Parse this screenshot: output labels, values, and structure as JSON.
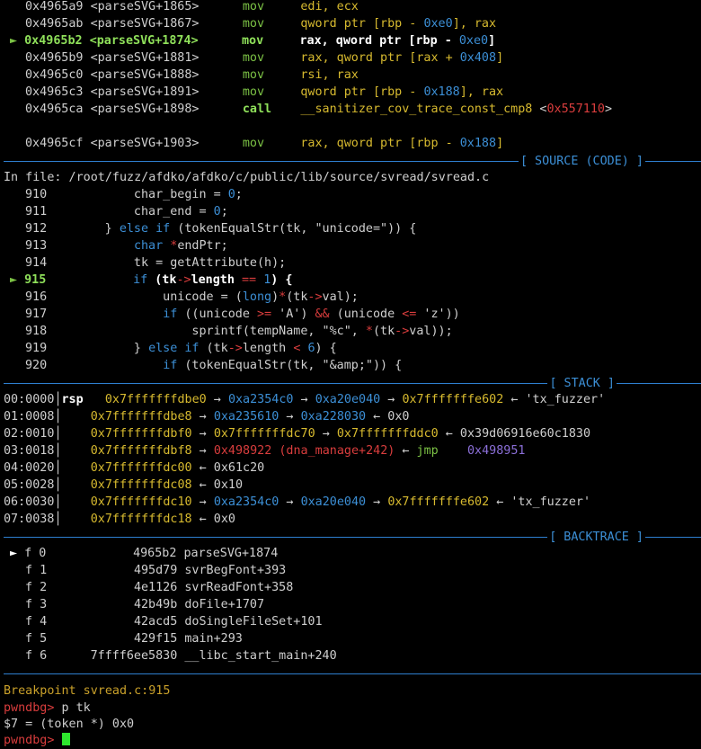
{
  "disasm": [
    {
      "addr": "0x4965a9",
      "sym": "<parseSVG+1865>",
      "op": "mov",
      "args": [
        {
          "t": "edi, ecx",
          "c": "yel"
        }
      ]
    },
    {
      "addr": "0x4965ab",
      "sym": "<parseSVG+1867>",
      "op": "mov",
      "args": [
        {
          "t": "qword ptr [rbp - ",
          "c": "yel"
        },
        {
          "t": "0xe0",
          "c": "cy"
        },
        {
          "t": "], rax",
          "c": "yel"
        }
      ]
    },
    {
      "addr": "0x4965b2",
      "sym": "<parseSVG+1874>",
      "op": "mov",
      "current": true,
      "args": [
        {
          "t": "rax, qword ptr [rbp - ",
          "c": "wb"
        },
        {
          "t": "0xe0",
          "c": "cy"
        },
        {
          "t": "]",
          "c": "wb"
        }
      ]
    },
    {
      "addr": "0x4965b9",
      "sym": "<parseSVG+1881>",
      "op": "mov",
      "args": [
        {
          "t": "rax, qword ptr [rax + ",
          "c": "yel"
        },
        {
          "t": "0x408",
          "c": "cy"
        },
        {
          "t": "]",
          "c": "yel"
        }
      ]
    },
    {
      "addr": "0x4965c0",
      "sym": "<parseSVG+1888>",
      "op": "mov",
      "args": [
        {
          "t": "rsi, rax",
          "c": "yel"
        }
      ]
    },
    {
      "addr": "0x4965c3",
      "sym": "<parseSVG+1891>",
      "op": "mov",
      "args": [
        {
          "t": "qword ptr [rbp - ",
          "c": "yel"
        },
        {
          "t": "0x188",
          "c": "cy"
        },
        {
          "t": "], rax",
          "c": "yel"
        }
      ]
    },
    {
      "addr": "0x4965ca",
      "sym": "<parseSVG+1898>",
      "op": "call",
      "args": [
        {
          "t": "__sanitizer_cov_trace_const_cmp8",
          "c": "yel"
        },
        {
          "t": " <",
          "c": "w"
        },
        {
          "t": "0x557110",
          "c": "red"
        },
        {
          "t": ">",
          "c": "w"
        }
      ]
    },
    {
      "blank": true
    },
    {
      "addr": "0x4965cf",
      "sym": "<parseSVG+1903>",
      "op": "mov",
      "args": [
        {
          "t": "rax, qword ptr [rbp - ",
          "c": "yel"
        },
        {
          "t": "0x188",
          "c": "cy"
        },
        {
          "t": "]",
          "c": "yel"
        }
      ]
    }
  ],
  "sections": {
    "source": "[ SOURCE (CODE) ]",
    "stack": "[ STACK ]",
    "backtrace": "[ BACKTRACE ]"
  },
  "source": {
    "file_line": "In file: /root/fuzz/afdko/afdko/c/public/lib/source/svread/svread.c",
    "lines": [
      {
        "no": "910",
        "segs": [
          {
            "t": "            char_begin = ",
            "c": "w"
          },
          {
            "t": "0",
            "c": "cy"
          },
          {
            "t": ";",
            "c": "w"
          }
        ]
      },
      {
        "no": "911",
        "segs": [
          {
            "t": "            char_end = ",
            "c": "w"
          },
          {
            "t": "0",
            "c": "cy"
          },
          {
            "t": ";",
            "c": "w"
          }
        ]
      },
      {
        "no": "912",
        "segs": [
          {
            "t": "        } ",
            "c": "w"
          },
          {
            "t": "else if",
            "c": "cy"
          },
          {
            "t": " (tokenEqualStr(tk, ",
            "c": "w"
          },
          {
            "t": "\"unicode=\"",
            "c": "w"
          },
          {
            "t": ")) {",
            "c": "w"
          }
        ]
      },
      {
        "no": "913",
        "segs": [
          {
            "t": "            ",
            "c": "w"
          },
          {
            "t": "char",
            "c": "cy"
          },
          {
            "t": " ",
            "c": "w"
          },
          {
            "t": "*",
            "c": "red"
          },
          {
            "t": "endPtr;",
            "c": "w"
          }
        ]
      },
      {
        "no": "914",
        "segs": [
          {
            "t": "            tk = getAttribute(h);",
            "c": "w"
          }
        ]
      },
      {
        "no": "915",
        "current": true,
        "segs": [
          {
            "t": "            ",
            "c": "w"
          },
          {
            "t": "if",
            "c": "cy"
          },
          {
            "t": " (tk",
            "c": "wb"
          },
          {
            "t": "->",
            "c": "red"
          },
          {
            "t": "length ",
            "c": "wb"
          },
          {
            "t": "==",
            "c": "red"
          },
          {
            "t": " ",
            "c": "wb"
          },
          {
            "t": "1",
            "c": "cy"
          },
          {
            "t": ") {",
            "c": "wb"
          }
        ]
      },
      {
        "no": "916",
        "segs": [
          {
            "t": "                unicode = (",
            "c": "w"
          },
          {
            "t": "long",
            "c": "cy"
          },
          {
            "t": ")",
            "c": "w"
          },
          {
            "t": "*",
            "c": "red"
          },
          {
            "t": "(tk",
            "c": "w"
          },
          {
            "t": "->",
            "c": "red"
          },
          {
            "t": "val);",
            "c": "w"
          }
        ]
      },
      {
        "no": "917",
        "segs": [
          {
            "t": "                ",
            "c": "w"
          },
          {
            "t": "if",
            "c": "cy"
          },
          {
            "t": " ((unicode ",
            "c": "w"
          },
          {
            "t": ">=",
            "c": "red"
          },
          {
            "t": " 'A') ",
            "c": "w"
          },
          {
            "t": "&&",
            "c": "red"
          },
          {
            "t": " (unicode ",
            "c": "w"
          },
          {
            "t": "<=",
            "c": "red"
          },
          {
            "t": " 'z'))",
            "c": "w"
          }
        ]
      },
      {
        "no": "918",
        "segs": [
          {
            "t": "                    sprintf(tempName, \"%c\", ",
            "c": "w"
          },
          {
            "t": "*",
            "c": "red"
          },
          {
            "t": "(tk",
            "c": "w"
          },
          {
            "t": "->",
            "c": "red"
          },
          {
            "t": "val));",
            "c": "w"
          }
        ]
      },
      {
        "no": "919",
        "segs": [
          {
            "t": "            } ",
            "c": "w"
          },
          {
            "t": "else if",
            "c": "cy"
          },
          {
            "t": " (tk",
            "c": "w"
          },
          {
            "t": "->",
            "c": "red"
          },
          {
            "t": "length ",
            "c": "w"
          },
          {
            "t": "<",
            "c": "red"
          },
          {
            "t": " ",
            "c": "w"
          },
          {
            "t": "6",
            "c": "cy"
          },
          {
            "t": ") {",
            "c": "w"
          }
        ]
      },
      {
        "no": "920",
        "segs": [
          {
            "t": "                ",
            "c": "w"
          },
          {
            "t": "if",
            "c": "cy"
          },
          {
            "t": " (tokenEqualStr(tk, \"&amp;\")) {",
            "c": "w"
          }
        ]
      }
    ]
  },
  "stack": [
    {
      "idx": "00:0000",
      "reg": "rsp",
      "segs": [
        {
          "t": "0x7fffffffdbe0",
          "c": "yel"
        },
        {
          "t": " → ",
          "c": "w"
        },
        {
          "t": "0xa2354c0",
          "c": "cy"
        },
        {
          "t": " → ",
          "c": "w"
        },
        {
          "t": "0xa20e040",
          "c": "cy"
        },
        {
          "t": " → ",
          "c": "w"
        },
        {
          "t": "0x7fffffffe602",
          "c": "yel"
        },
        {
          "t": " ← ",
          "c": "w"
        },
        {
          "t": "'tx_fuzzer'",
          "c": "w"
        }
      ]
    },
    {
      "idx": "01:0008",
      "reg": "",
      "segs": [
        {
          "t": "0x7fffffffdbe8",
          "c": "yel"
        },
        {
          "t": " → ",
          "c": "w"
        },
        {
          "t": "0xa235610",
          "c": "cy"
        },
        {
          "t": " → ",
          "c": "w"
        },
        {
          "t": "0xa228030",
          "c": "cy"
        },
        {
          "t": " ← 0x0",
          "c": "w"
        }
      ]
    },
    {
      "idx": "02:0010",
      "reg": "",
      "segs": [
        {
          "t": "0x7fffffffdbf0",
          "c": "yel"
        },
        {
          "t": " → ",
          "c": "w"
        },
        {
          "t": "0x7fffffffdc70",
          "c": "yel"
        },
        {
          "t": " → ",
          "c": "w"
        },
        {
          "t": "0x7fffffffddc0",
          "c": "yel"
        },
        {
          "t": " ← 0x39d06916e60c1830",
          "c": "w"
        }
      ]
    },
    {
      "idx": "03:0018",
      "reg": "",
      "segs": [
        {
          "t": "0x7fffffffdbf8",
          "c": "yel"
        },
        {
          "t": " → ",
          "c": "w"
        },
        {
          "t": "0x498922 (dna_manage+242)",
          "c": "red"
        },
        {
          "t": " ← ",
          "c": "w"
        },
        {
          "t": "jmp",
          "c": "grn"
        },
        {
          "t": "    ",
          "c": "w"
        },
        {
          "t": "0x498951",
          "c": "pur"
        }
      ]
    },
    {
      "idx": "04:0020",
      "reg": "",
      "segs": [
        {
          "t": "0x7fffffffdc00",
          "c": "yel"
        },
        {
          "t": " ← 0x61c20",
          "c": "w"
        }
      ]
    },
    {
      "idx": "05:0028",
      "reg": "",
      "segs": [
        {
          "t": "0x7fffffffdc08",
          "c": "yel"
        },
        {
          "t": " ← 0x10",
          "c": "w"
        }
      ]
    },
    {
      "idx": "06:0030",
      "reg": "",
      "segs": [
        {
          "t": "0x7fffffffdc10",
          "c": "yel"
        },
        {
          "t": " → ",
          "c": "w"
        },
        {
          "t": "0xa2354c0",
          "c": "cy"
        },
        {
          "t": " → ",
          "c": "w"
        },
        {
          "t": "0xa20e040",
          "c": "cy"
        },
        {
          "t": " → ",
          "c": "w"
        },
        {
          "t": "0x7fffffffe602",
          "c": "yel"
        },
        {
          "t": " ← ",
          "c": "w"
        },
        {
          "t": "'tx_fuzzer'",
          "c": "w"
        }
      ]
    },
    {
      "idx": "07:0038",
      "reg": "",
      "segs": [
        {
          "t": "0x7fffffffdc18",
          "c": "yel"
        },
        {
          "t": " ← 0x0",
          "c": "w"
        }
      ]
    }
  ],
  "backtrace": [
    {
      "frame": "f 0",
      "addr": "4965b2",
      "sym": "parseSVG+1874",
      "current": true
    },
    {
      "frame": "f 1",
      "addr": "495d79",
      "sym": "svrBegFont+393"
    },
    {
      "frame": "f 2",
      "addr": "4e1126",
      "sym": "svrReadFont+358"
    },
    {
      "frame": "f 3",
      "addr": "42b49b",
      "sym": "doFile+1707"
    },
    {
      "frame": "f 4",
      "addr": "42acd5",
      "sym": "doSingleFileSet+101"
    },
    {
      "frame": "f 5",
      "addr": "429f15",
      "sym": "main+293"
    },
    {
      "frame": "f 6",
      "addr": "7ffff6ee5830",
      "sym": "__libc_start_main+240"
    }
  ],
  "console": {
    "breakpoint": "Breakpoint svread.c:915",
    "prompt": "pwndbg>",
    "command": "p tk",
    "result": "$7 = (token *) 0x0",
    "prompt2_partial": "pwndbg>"
  }
}
